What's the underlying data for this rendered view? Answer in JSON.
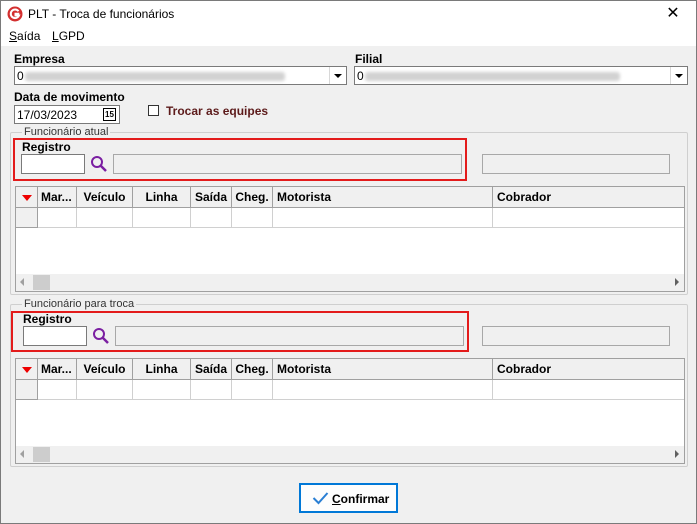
{
  "window": {
    "title": "PLT - Troca de funcionários",
    "close_glyph": "✕"
  },
  "menu": {
    "items": [
      {
        "label": "Saída",
        "accel": "S",
        "rest": "aída"
      },
      {
        "label": "LGPD",
        "accel": "L",
        "rest": "GPD"
      }
    ]
  },
  "empresa": {
    "label": "Empresa",
    "value": "0"
  },
  "filial": {
    "label": "Filial",
    "value": "0"
  },
  "data_movimento": {
    "label": "Data de movimento",
    "value": "17/03/2023",
    "calendar_glyph": "15"
  },
  "trocar_equipes": {
    "label": "Trocar as equipes",
    "checked": false
  },
  "group_atual": {
    "title": "Funcionário atual",
    "registro_label": "Registro",
    "registro_value": ""
  },
  "group_troca": {
    "title": "Funcionário para troca",
    "registro_label": "Registro",
    "registro_value": ""
  },
  "grid_columns": [
    "Mar...",
    "Veículo",
    "Linha",
    "Saída",
    "Cheg.",
    "Motorista",
    "Cobrador"
  ],
  "confirm_button": {
    "label": "Confirmar",
    "accel": "C",
    "rest": "onfirmar"
  },
  "colors": {
    "highlight": "#e31b1b",
    "accent": "#0078d7",
    "search_icon": "#7b1fa2",
    "checkbox_label": "#5c1a1a"
  }
}
